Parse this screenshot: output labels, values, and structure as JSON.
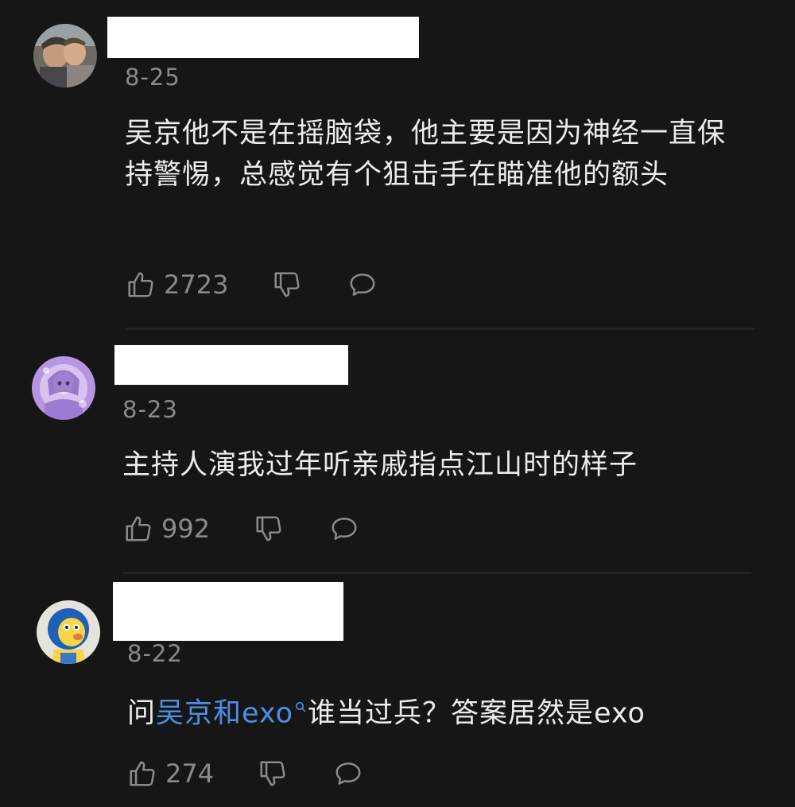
{
  "comments": [
    {
      "date": "8-25",
      "text": "吴京他不是在摇脑袋，他主要是因为神经一直保持警惕，总感觉有个狙击手在瞄准他的额头",
      "likes": "2723"
    },
    {
      "date": "8-23",
      "text": "主持人演我过年听亲戚指点江山时的样子",
      "likes": "992"
    },
    {
      "date": "8-22",
      "text_prefix": "问",
      "text_link": "吴京和exo",
      "text_suffix": "谁当过兵？答案居然是exo",
      "likes": "274"
    }
  ],
  "icons": {
    "like": "thumbs-up-icon",
    "dislike": "thumbs-down-icon",
    "reply": "speech-bubble-icon",
    "search": "search-icon"
  },
  "colors": {
    "background": "#161617",
    "text": "#ececec",
    "meta": "#8a8a8c",
    "link": "#4e8fe6"
  }
}
